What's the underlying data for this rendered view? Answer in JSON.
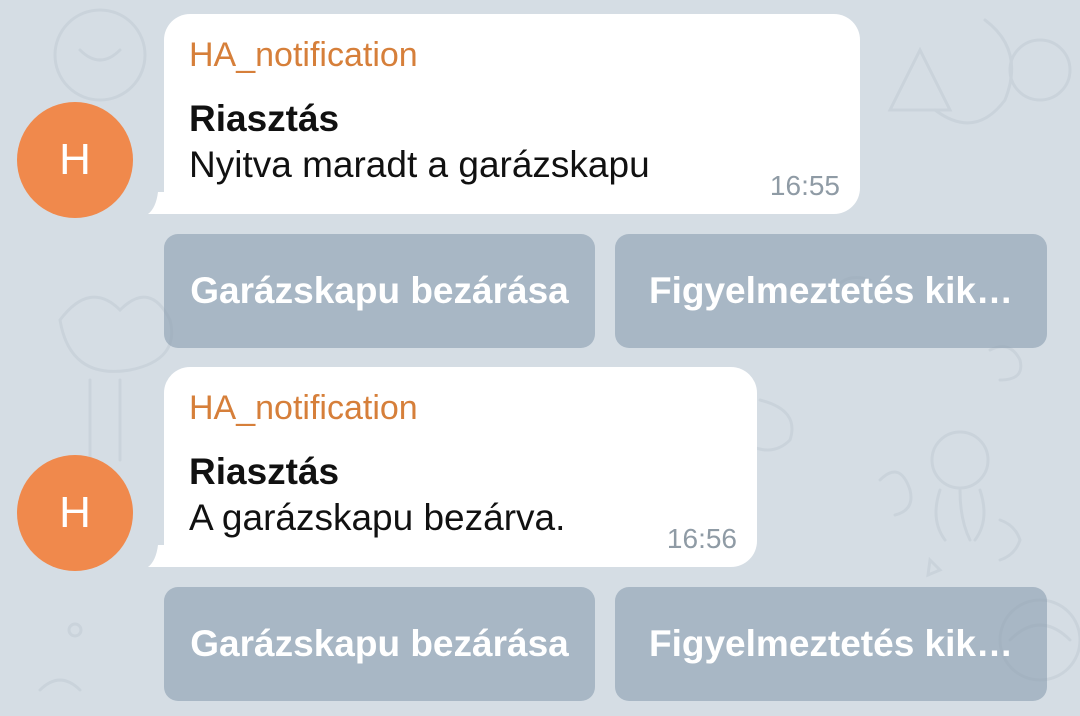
{
  "messages": [
    {
      "avatar_initial": "H",
      "sender": "HA_notification",
      "title": "Riasztás",
      "text": "Nyitva maradt a garázskapu",
      "time": "16:55",
      "buttons": [
        "Garázskapu bezárása",
        "Figyelmeztetés kik…"
      ]
    },
    {
      "avatar_initial": "H",
      "sender": "HA_notification",
      "title": "Riasztás",
      "text": "A garázskapu bezárva.",
      "time": "16:56",
      "buttons": [
        "Garázskapu bezárása",
        "Figyelmeztetés kik…"
      ]
    }
  ],
  "colors": {
    "background": "#d5dde4",
    "avatar": "#f0894c",
    "sender_name": "#d67f3a",
    "bubble": "#ffffff",
    "inline_button": "#8da0b2"
  }
}
